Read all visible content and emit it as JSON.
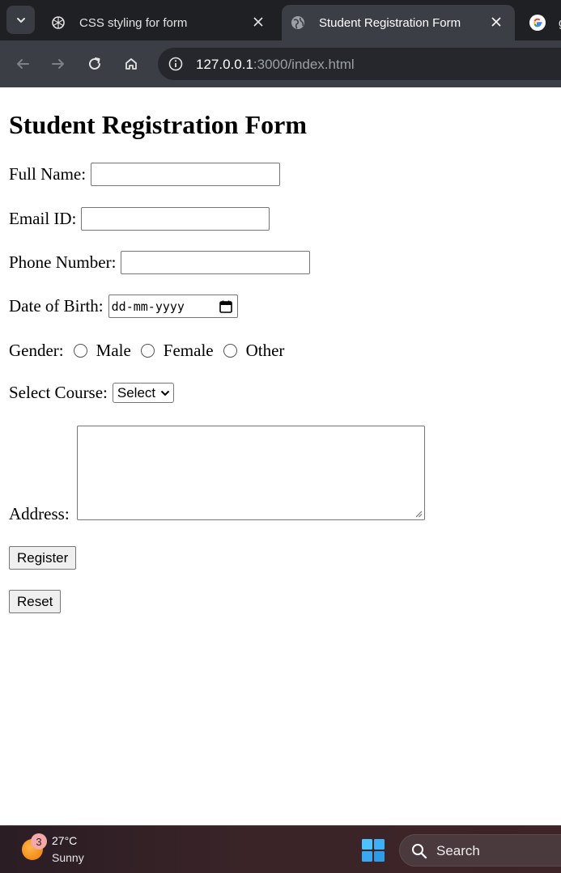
{
  "browser": {
    "tabs": [
      {
        "title": "CSS styling for form",
        "icon": "chatgpt-icon",
        "active": false
      },
      {
        "title": "Student Registration Form",
        "icon": "globe-icon",
        "active": true
      },
      {
        "title": "g",
        "icon": "google-icon",
        "active": false
      }
    ],
    "url_host": "127.0.0.1",
    "url_path": ":3000/index.html"
  },
  "form": {
    "heading": "Student Registration Form",
    "full_name_label": "Full Name:",
    "email_label": "Email ID:",
    "phone_label": "Phone Number:",
    "dob_label": "Date of Birth:",
    "dob_placeholder": "dd-mm-yyyy",
    "gender_label": "Gender:",
    "gender_options": [
      "Male",
      "Female",
      "Other"
    ],
    "course_label": "Select Course:",
    "course_selected": "Select",
    "address_label": "Address:",
    "register_button": "Register",
    "reset_button": "Reset"
  },
  "taskbar": {
    "weather_badge": "3",
    "temperature": "27°C",
    "condition": "Sunny",
    "search_placeholder": "Search"
  }
}
